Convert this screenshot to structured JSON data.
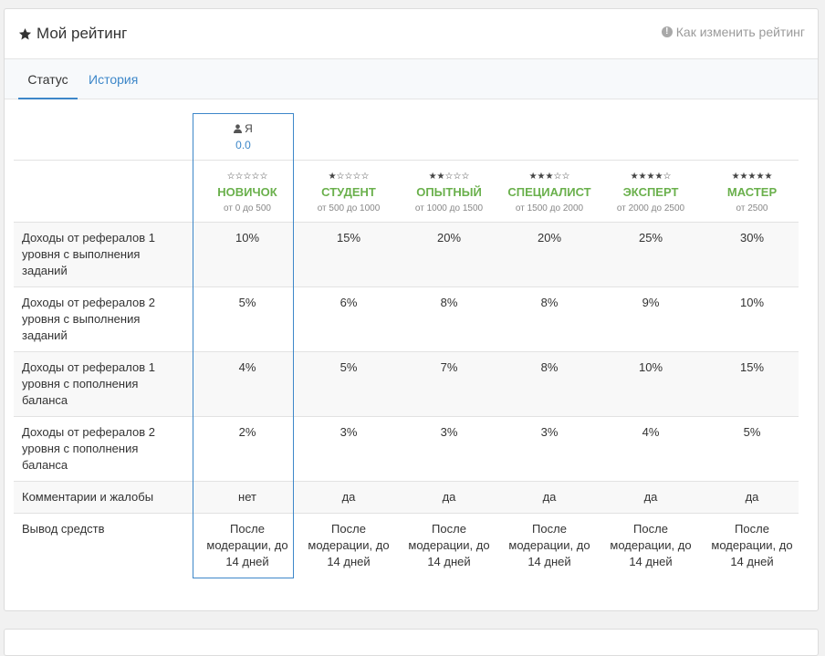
{
  "header": {
    "title": "Мой рейтинг",
    "howto": "Как изменить рейтинг"
  },
  "tabs": [
    {
      "label": "Статус"
    },
    {
      "label": "История"
    }
  ],
  "me": {
    "name": "Я",
    "score": "0.0"
  },
  "levels": [
    {
      "stars": "☆☆☆☆☆",
      "name": "НОВИЧОК",
      "range": "от 0 до 500"
    },
    {
      "stars": "★☆☆☆☆",
      "name": "СТУДЕНТ",
      "range": "от 500 до 1000"
    },
    {
      "stars": "★★☆☆☆",
      "name": "ОПЫТНЫЙ",
      "range": "от 1000 до 1500"
    },
    {
      "stars": "★★★☆☆",
      "name": "СПЕЦИАЛИСТ",
      "range": "от 1500 до 2000"
    },
    {
      "stars": "★★★★☆",
      "name": "ЭКСПЕРТ",
      "range": "от 2000 до 2500"
    },
    {
      "stars": "★★★★★",
      "name": "МАСТЕР",
      "range": "от 2500"
    }
  ],
  "rows": [
    {
      "label": "Доходы от рефералов 1 уровня с выполнения заданий",
      "values": [
        "10%",
        "15%",
        "20%",
        "20%",
        "25%",
        "30%"
      ]
    },
    {
      "label": "Доходы от рефералов 2 уровня с выполнения заданий",
      "values": [
        "5%",
        "6%",
        "8%",
        "8%",
        "9%",
        "10%"
      ]
    },
    {
      "label": "Доходы от рефералов 1 уровня с пополнения баланса",
      "values": [
        "4%",
        "5%",
        "7%",
        "8%",
        "10%",
        "15%"
      ]
    },
    {
      "label": "Доходы от рефералов 2 уровня с пополнения баланса",
      "values": [
        "2%",
        "3%",
        "3%",
        "3%",
        "4%",
        "5%"
      ]
    },
    {
      "label": "Комментарии и жалобы",
      "values": [
        "нет",
        "да",
        "да",
        "да",
        "да",
        "да"
      ]
    },
    {
      "label": "Вывод средств",
      "values": [
        "После модерации, до 14 дней",
        "После модерации, до 14 дней",
        "После модерации, до 14 дней",
        "После модерации, до 14 дней",
        "После модерации, до 14 дней",
        "После модерации, до 14 дней"
      ]
    }
  ],
  "colors": {
    "accent": "#3d87c9",
    "level": "#6ab04c"
  }
}
